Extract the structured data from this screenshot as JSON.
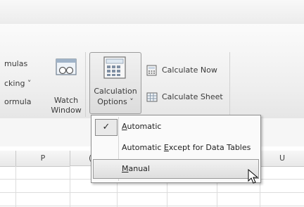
{
  "ribbon": {
    "formulas_group": {
      "lines": [
        "mulas",
        "cking ˅",
        "ormula"
      ]
    },
    "watch_window": {
      "line1": "Watch",
      "line2": "Window"
    },
    "calculation_options": {
      "line1": "Calculation",
      "line2": "Options ˅"
    },
    "calculate_now": "Calculate Now",
    "calculate_sheet": "Calculate Sheet"
  },
  "menu": {
    "items": [
      {
        "label_pre": "",
        "accel": "A",
        "label_post": "utomatic",
        "checked": true
      },
      {
        "label_pre": "Automatic ",
        "accel": "E",
        "label_post": "xcept for Data Tables",
        "checked": false
      },
      {
        "label_pre": "",
        "accel": "M",
        "label_post": "anual",
        "checked": false
      }
    ],
    "check_glyph": "✓"
  },
  "grid": {
    "columns": [
      "P",
      "(",
      "U"
    ]
  }
}
